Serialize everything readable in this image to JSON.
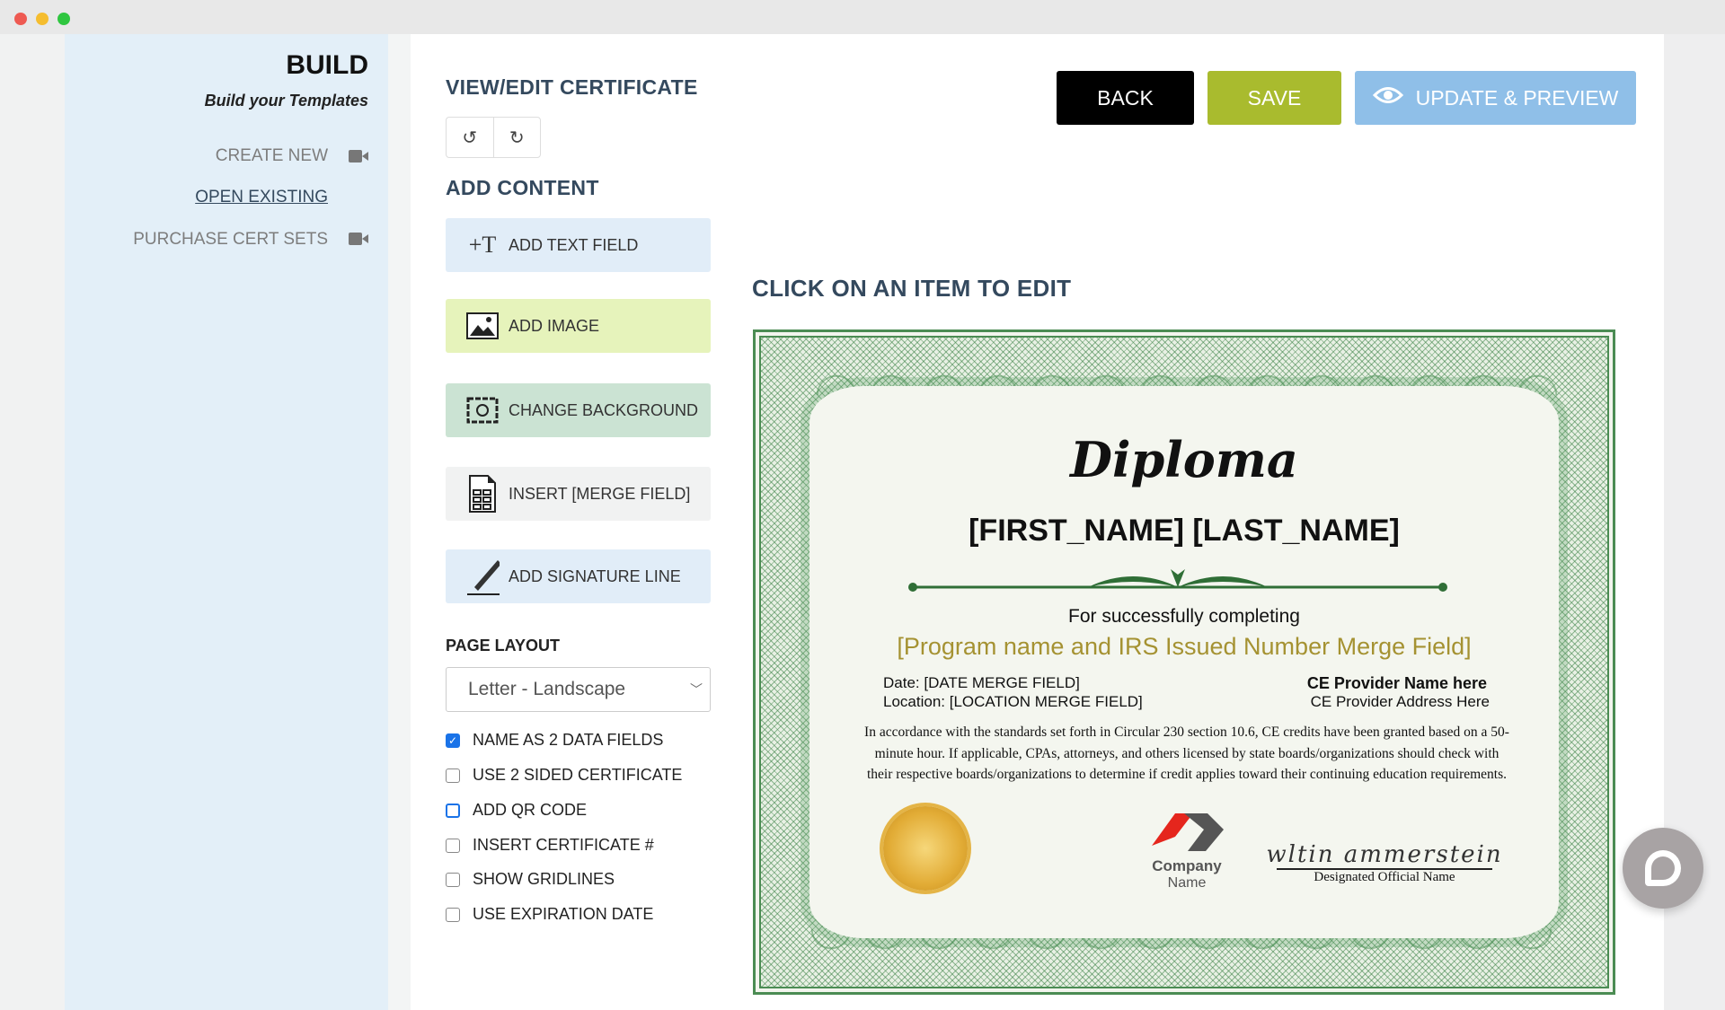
{
  "window": {
    "controls": [
      "#ee5a52",
      "#f5bd2f",
      "#2fc640"
    ]
  },
  "sidebar": {
    "title": "BUILD",
    "subtitle": "Build your Templates",
    "items": [
      {
        "label": "CREATE NEW",
        "icon": "video-camera-icon"
      },
      {
        "label": "OPEN EXISTING"
      },
      {
        "label": "PURCHASE CERT SETS",
        "icon": "video-camera-icon"
      }
    ]
  },
  "editor": {
    "title": "VIEW/EDIT CERTIFICATE",
    "undo": "↺",
    "redo": "↻",
    "add_content_heading": "ADD CONTENT",
    "buttons": [
      {
        "label": "ADD TEXT FIELD",
        "color": "#e1edf8"
      },
      {
        "label": "ADD IMAGE",
        "color": "#e6f3bb"
      },
      {
        "label": "CHANGE BACKGROUND",
        "color": "#cbe3d3"
      },
      {
        "label": "INSERT [MERGE FIELD]",
        "color": "#f1f2f2"
      },
      {
        "label": "ADD SIGNATURE LINE",
        "color": "#e1edf8"
      }
    ],
    "page_layout_heading": "PAGE LAYOUT",
    "page_layout_value": "Letter - Landscape",
    "options": [
      {
        "label": "NAME AS 2 DATA FIELDS",
        "checked": true
      },
      {
        "label": "USE 2 SIDED CERTIFICATE",
        "checked": false
      },
      {
        "label": "ADD QR CODE",
        "checked": false,
        "focused": true
      },
      {
        "label": "INSERT CERTIFICATE #",
        "checked": false
      },
      {
        "label": "SHOW GRIDLINES",
        "checked": false
      },
      {
        "label": "USE EXPIRATION DATE",
        "checked": false
      }
    ]
  },
  "toolbar": {
    "back": "BACK",
    "save": "SAVE",
    "update": "UPDATE & PREVIEW",
    "back_color": "#000000",
    "save_color": "#a9bb2e",
    "update_color": "#8fbfe8"
  },
  "preview": {
    "heading": "CLICK ON AN ITEM TO EDIT"
  },
  "certificate": {
    "title": "Diploma",
    "name": "[FIRST_NAME] [LAST_NAME]",
    "completing": "For successfully completing",
    "program": "[Program name and IRS Issued Number Merge Field]",
    "date": "Date: [DATE MERGE FIELD]",
    "location": "Location: [LOCATION MERGE FIELD]",
    "provider_name": "CE Provider Name here",
    "provider_address": "CE Provider Address Here",
    "statement": "In accordance with the standards set forth in Circular 230 section 10.6, CE credits have been granted based on a 50-minute hour.  If applicable, CPAs, attorneys, and others licensed by state boards/organizations should check with their respective boards/organizations to determine if credit applies toward their continuing education requirements.",
    "company_line1": "Company",
    "company_line2": "Name",
    "signature": "wltin ammerstein",
    "signature_label": "Designated Official Name"
  }
}
